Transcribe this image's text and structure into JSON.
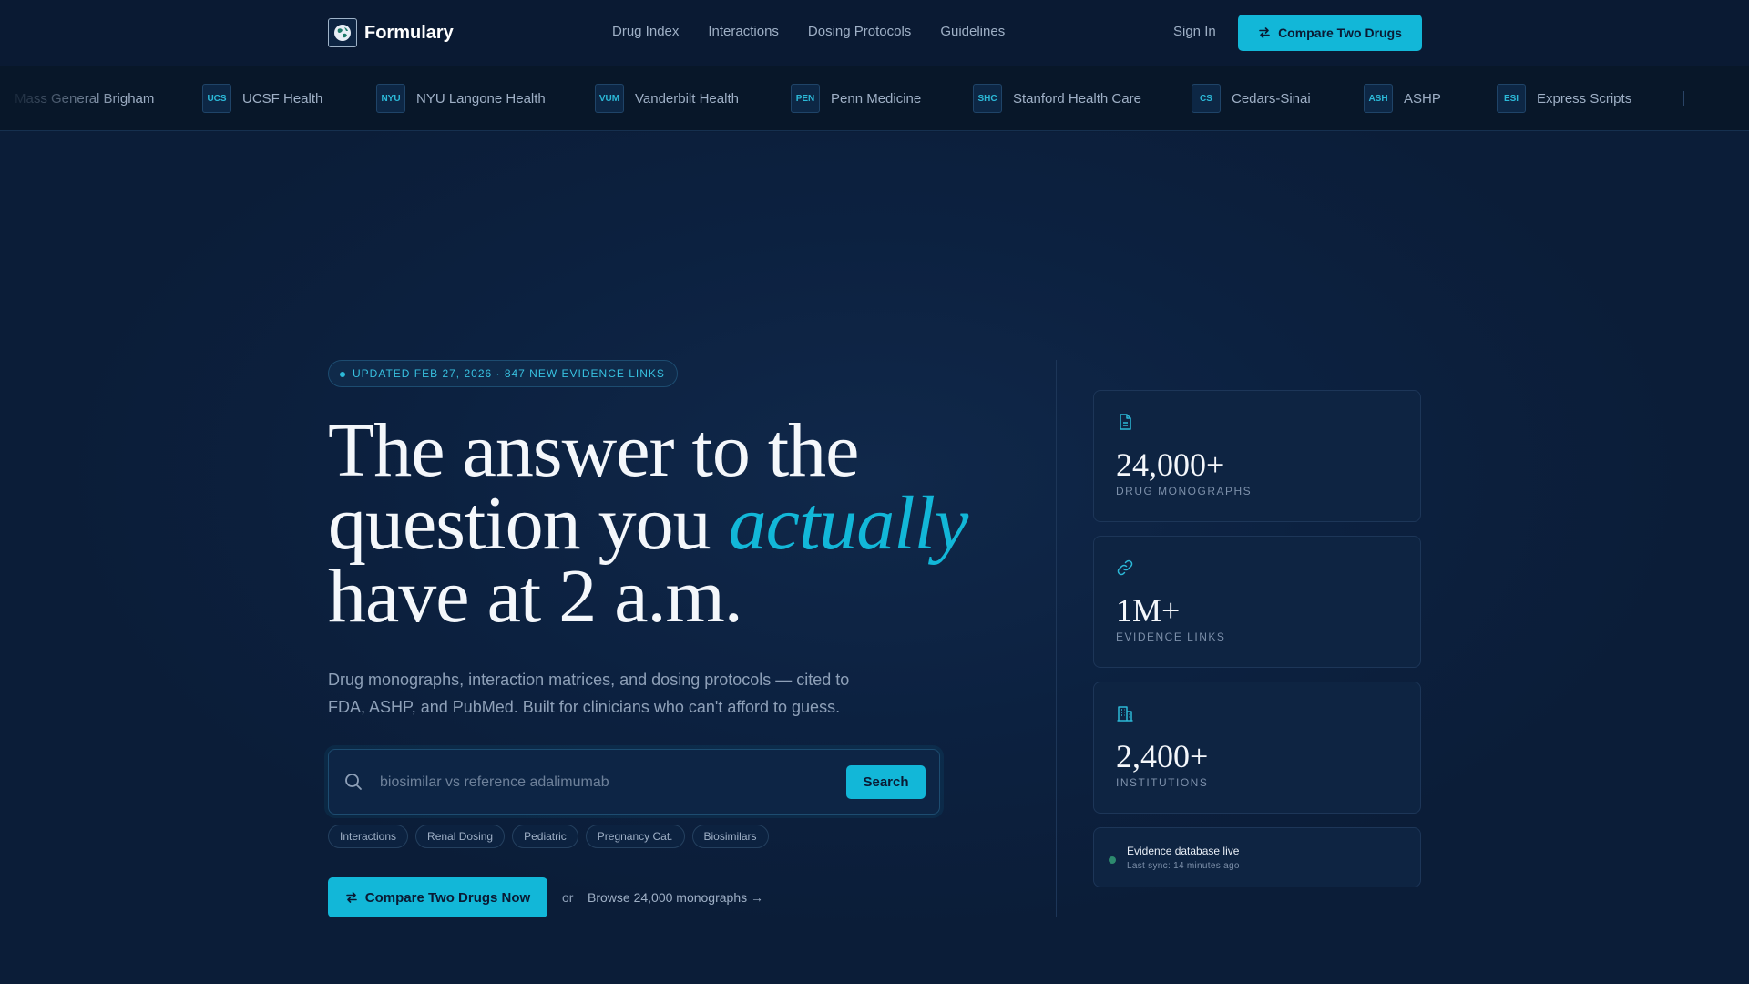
{
  "brand": {
    "name": "Formulary",
    "accent": "#12b7d8",
    "background": "#0b1d38"
  },
  "nav": {
    "items": [
      "Drug Index",
      "Interactions",
      "Dosing Protocols",
      "Guidelines"
    ],
    "sign_in": "Sign In",
    "cta": "Compare Two Drugs"
  },
  "marquee": {
    "items": [
      {
        "badge": "",
        "label": "Mass General Brigham"
      },
      {
        "badge": "UCS",
        "label": "UCSF Health"
      },
      {
        "badge": "NYU",
        "label": "NYU Langone Health"
      },
      {
        "badge": "VUM",
        "label": "Vanderbilt Health"
      },
      {
        "badge": "PEN",
        "label": "Penn Medicine"
      },
      {
        "badge": "SHC",
        "label": "Stanford Health Care"
      },
      {
        "badge": "CS",
        "label": "Cedars-Sinai"
      },
      {
        "badge": "ASH",
        "label": "ASHP"
      },
      {
        "badge": "ESI",
        "label": "Express Scripts"
      }
    ]
  },
  "hero": {
    "pill": "UPDATED FEB 27, 2026 · 847 NEW EVIDENCE LINKS",
    "headline_line1": "The answer to the",
    "headline_line2_pre": "question you ",
    "headline_emph": "actually",
    "headline_line3": "have at 2 a.m.",
    "subheadline": "Drug monographs, interaction matrices, and dosing protocols — cited to FDA, ASHP, and PubMed. Built for clinicians who can't afford to guess.",
    "search": {
      "value": "",
      "placeholder": "biosimilar vs reference adalimumab",
      "button": "Search"
    },
    "chips": [
      "Interactions",
      "Renal Dosing",
      "Pediatric",
      "Pregnancy Cat.",
      "Biosimilars"
    ],
    "cta": "Compare Two Drugs Now",
    "or": "or",
    "browse": "Browse 24,000 monographs →"
  },
  "stats": [
    {
      "icon": "document-icon",
      "value": "24,000+",
      "label": "DRUG MONOGRAPHS"
    },
    {
      "icon": "link-icon",
      "value": "1M+",
      "label": "EVIDENCE LINKS"
    },
    {
      "icon": "building-icon",
      "value": "2,400+",
      "label": "INSTITUTIONS"
    }
  ],
  "status": {
    "title": "Evidence database live",
    "subtitle": "Last sync: 14 minutes ago",
    "color": "#2d8a6e"
  }
}
